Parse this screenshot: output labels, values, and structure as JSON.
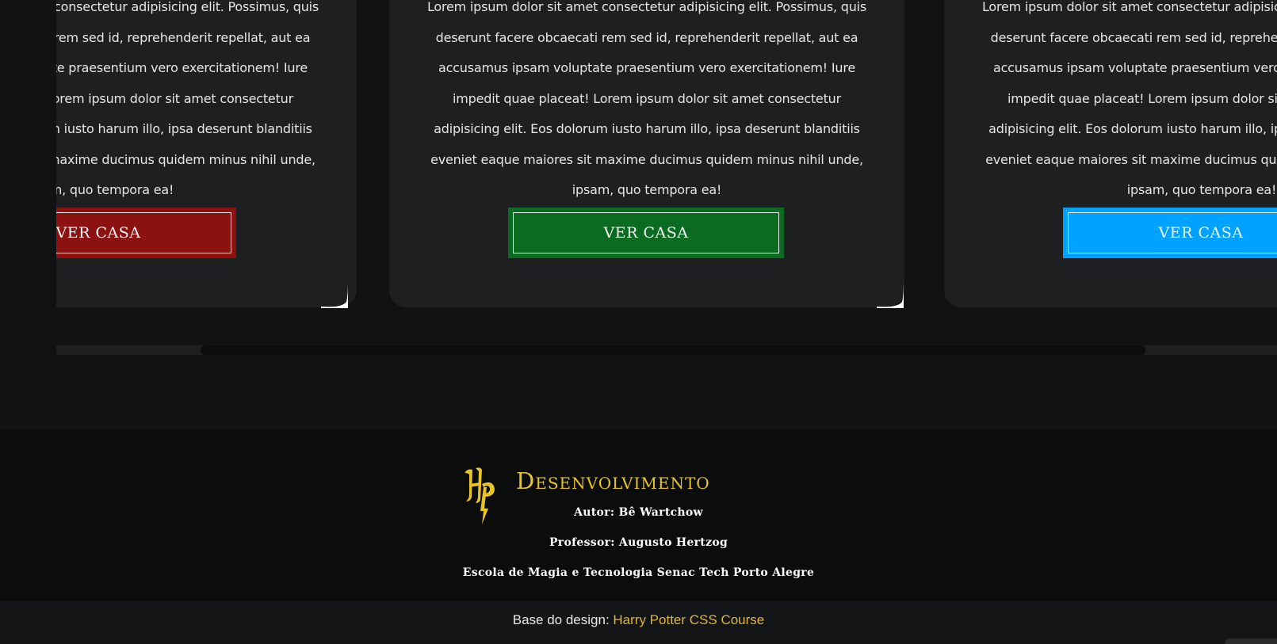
{
  "cards": [
    {
      "text": "Lorem ipsum dolor sit amet consectetur adipisicing elit. Possimus, quis deserunt facere obcaecati rem sed id, reprehenderit repellat, aut ea accusamus ipsam voluptate praesentium vero exercitationem! Iure impedit quae placeat! Lorem ipsum dolor sit amet consectetur adipisicing elit. Eos dolorum iusto harum illo, ipsa deserunt blanditiis eveniet eaque maiores sit maxime ducimus quidem minus nihil unde, ipsam, quo tempora ea!",
      "button_label": "VER CASA",
      "button_color": "#8c1212"
    },
    {
      "text": "Lorem ipsum dolor sit amet consectetur adipisicing elit. Possimus, quis deserunt facere obcaecati rem sed id, reprehenderit repellat, aut ea accusamus ipsam voluptate praesentium vero exercitationem! Iure impedit quae placeat! Lorem ipsum dolor sit amet consectetur adipisicing elit. Eos dolorum iusto harum illo, ipsa deserunt blanditiis eveniet eaque maiores sit maxime ducimus quidem minus nihil unde, ipsam, quo tempora ea!",
      "button_label": "VER CASA",
      "button_color": "#0b6b21"
    },
    {
      "text": "Lorem ipsum dolor sit amet consectetur adipisicing elit. Possimus, quis deserunt facere obcaecati rem sed id, reprehenderit repellat, aut ea accusamus ipsam voluptate praesentium vero exercitationem! Iure impedit quae placeat! Lorem ipsum dolor sit amet consectetur adipisicing elit. Eos dolorum iusto harum illo, ipsa deserunt blanditiis eveniet eaque maiores sit maxime ducimus quidem minus nihil unde, ipsam, quo tempora ea!",
      "button_label": "VER CASA",
      "button_color": "#00a2ff"
    }
  ],
  "footer": {
    "logo_icon": "hp-logo-icon",
    "title": "Desenvolvimento",
    "author": "Autor: Bê Wartchow",
    "professor": "Professor: Augusto Hertzog",
    "school": "Escola de Magia e Tecnologia Senac Tech Porto Alegre",
    "accent_color": "#e8c328"
  },
  "bottom_bar": {
    "credit_prefix": "Base do design:",
    "credit_link": "Harry Potter CSS Course",
    "link_color": "#e0b53a"
  }
}
